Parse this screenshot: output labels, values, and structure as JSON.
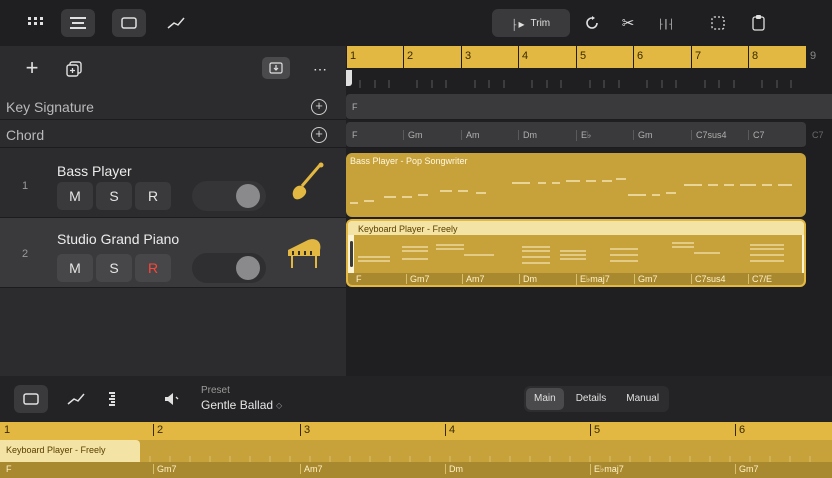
{
  "toolbar": {
    "trim_label": "Trim"
  },
  "tracks_header": {
    "key_signature_label": "Key Signature",
    "chord_label": "Chord"
  },
  "tracks": [
    {
      "number": "1",
      "name": "Bass Player",
      "m": "M",
      "s": "S",
      "r": "R"
    },
    {
      "number": "2",
      "name": "Studio Grand Piano",
      "m": "M",
      "s": "S",
      "r": "R"
    }
  ],
  "timeline": {
    "bars": [
      "1",
      "2",
      "3",
      "4",
      "5",
      "6",
      "7",
      "8",
      "9"
    ],
    "key_marker": "F",
    "chords": [
      "F",
      "Gm",
      "Am",
      "Dm",
      "E♭",
      "Gm",
      "C7sus4",
      "C7",
      "C7"
    ]
  },
  "regions": {
    "bass_title": "Bass Player - Pop Songwriter",
    "keys_title": "Keyboard Player - Freely",
    "keys_chords": [
      "F",
      "Gm7",
      "Am7",
      "Dm",
      "E♭maj7",
      "Gm7",
      "C7sus4",
      "C7/E"
    ]
  },
  "editor": {
    "preset_label": "Preset",
    "preset_value": "Gentle Ballad",
    "tabs": [
      "Main",
      "Details",
      "Manual"
    ],
    "active_tab": "Main",
    "bars": [
      "1",
      "2",
      "3",
      "4",
      "5",
      "6"
    ],
    "region_title": "Keyboard Player - Freely",
    "chords": [
      "F",
      "Gm7",
      "Am7",
      "Dm",
      "E♭maj7",
      "Gm7"
    ]
  },
  "colors": {
    "accent_yellow": "#e2b842",
    "region_yellow": "#c7a23b",
    "record_red": "#ff453a"
  }
}
